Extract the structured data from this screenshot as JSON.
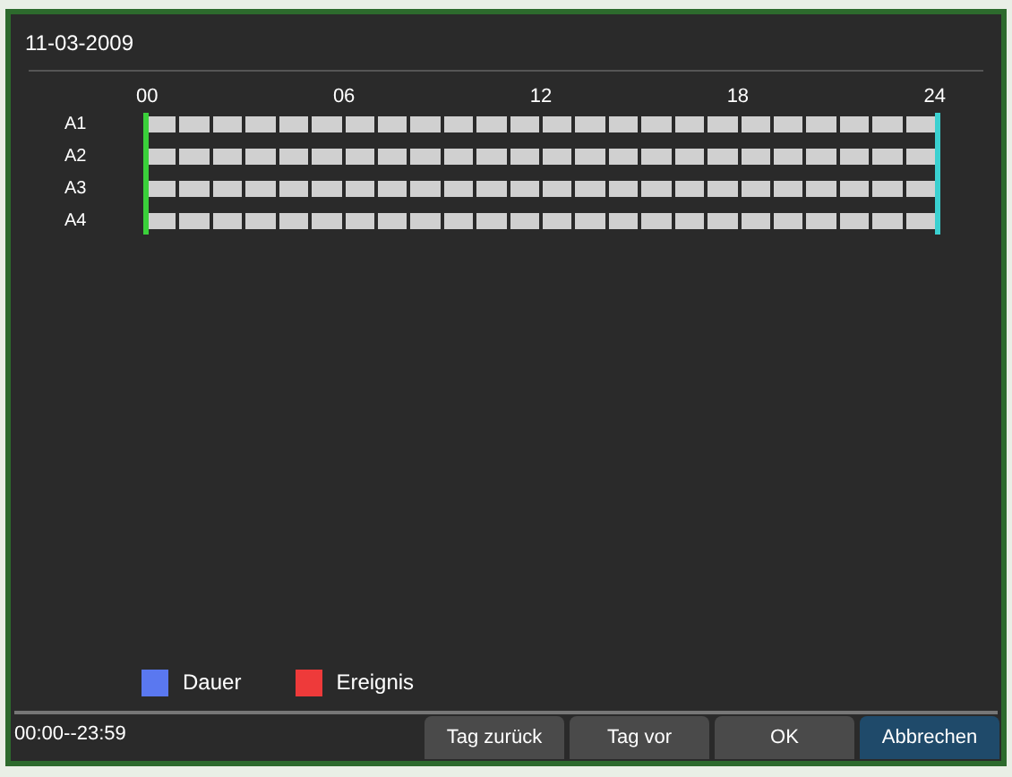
{
  "window": {
    "title": "11-03-2009"
  },
  "timeline": {
    "hour_labels": [
      "00",
      "06",
      "12",
      "18",
      "24"
    ],
    "channels": [
      {
        "name": "A1"
      },
      {
        "name": "A2"
      },
      {
        "name": "A3"
      },
      {
        "name": "A4"
      }
    ]
  },
  "legend": [
    {
      "label": "Dauer",
      "color": "#5a78f0"
    },
    {
      "label": "Ereignis",
      "color": "#ee3a3a"
    }
  ],
  "status_bar": {
    "time_range": "00:00--23:59"
  },
  "buttons": [
    {
      "label": "Tag zurück",
      "selected": false
    },
    {
      "label": "Tag vor",
      "selected": false
    },
    {
      "label": "OK",
      "selected": false
    },
    {
      "label": "Abbrechen",
      "selected": true
    }
  ]
}
